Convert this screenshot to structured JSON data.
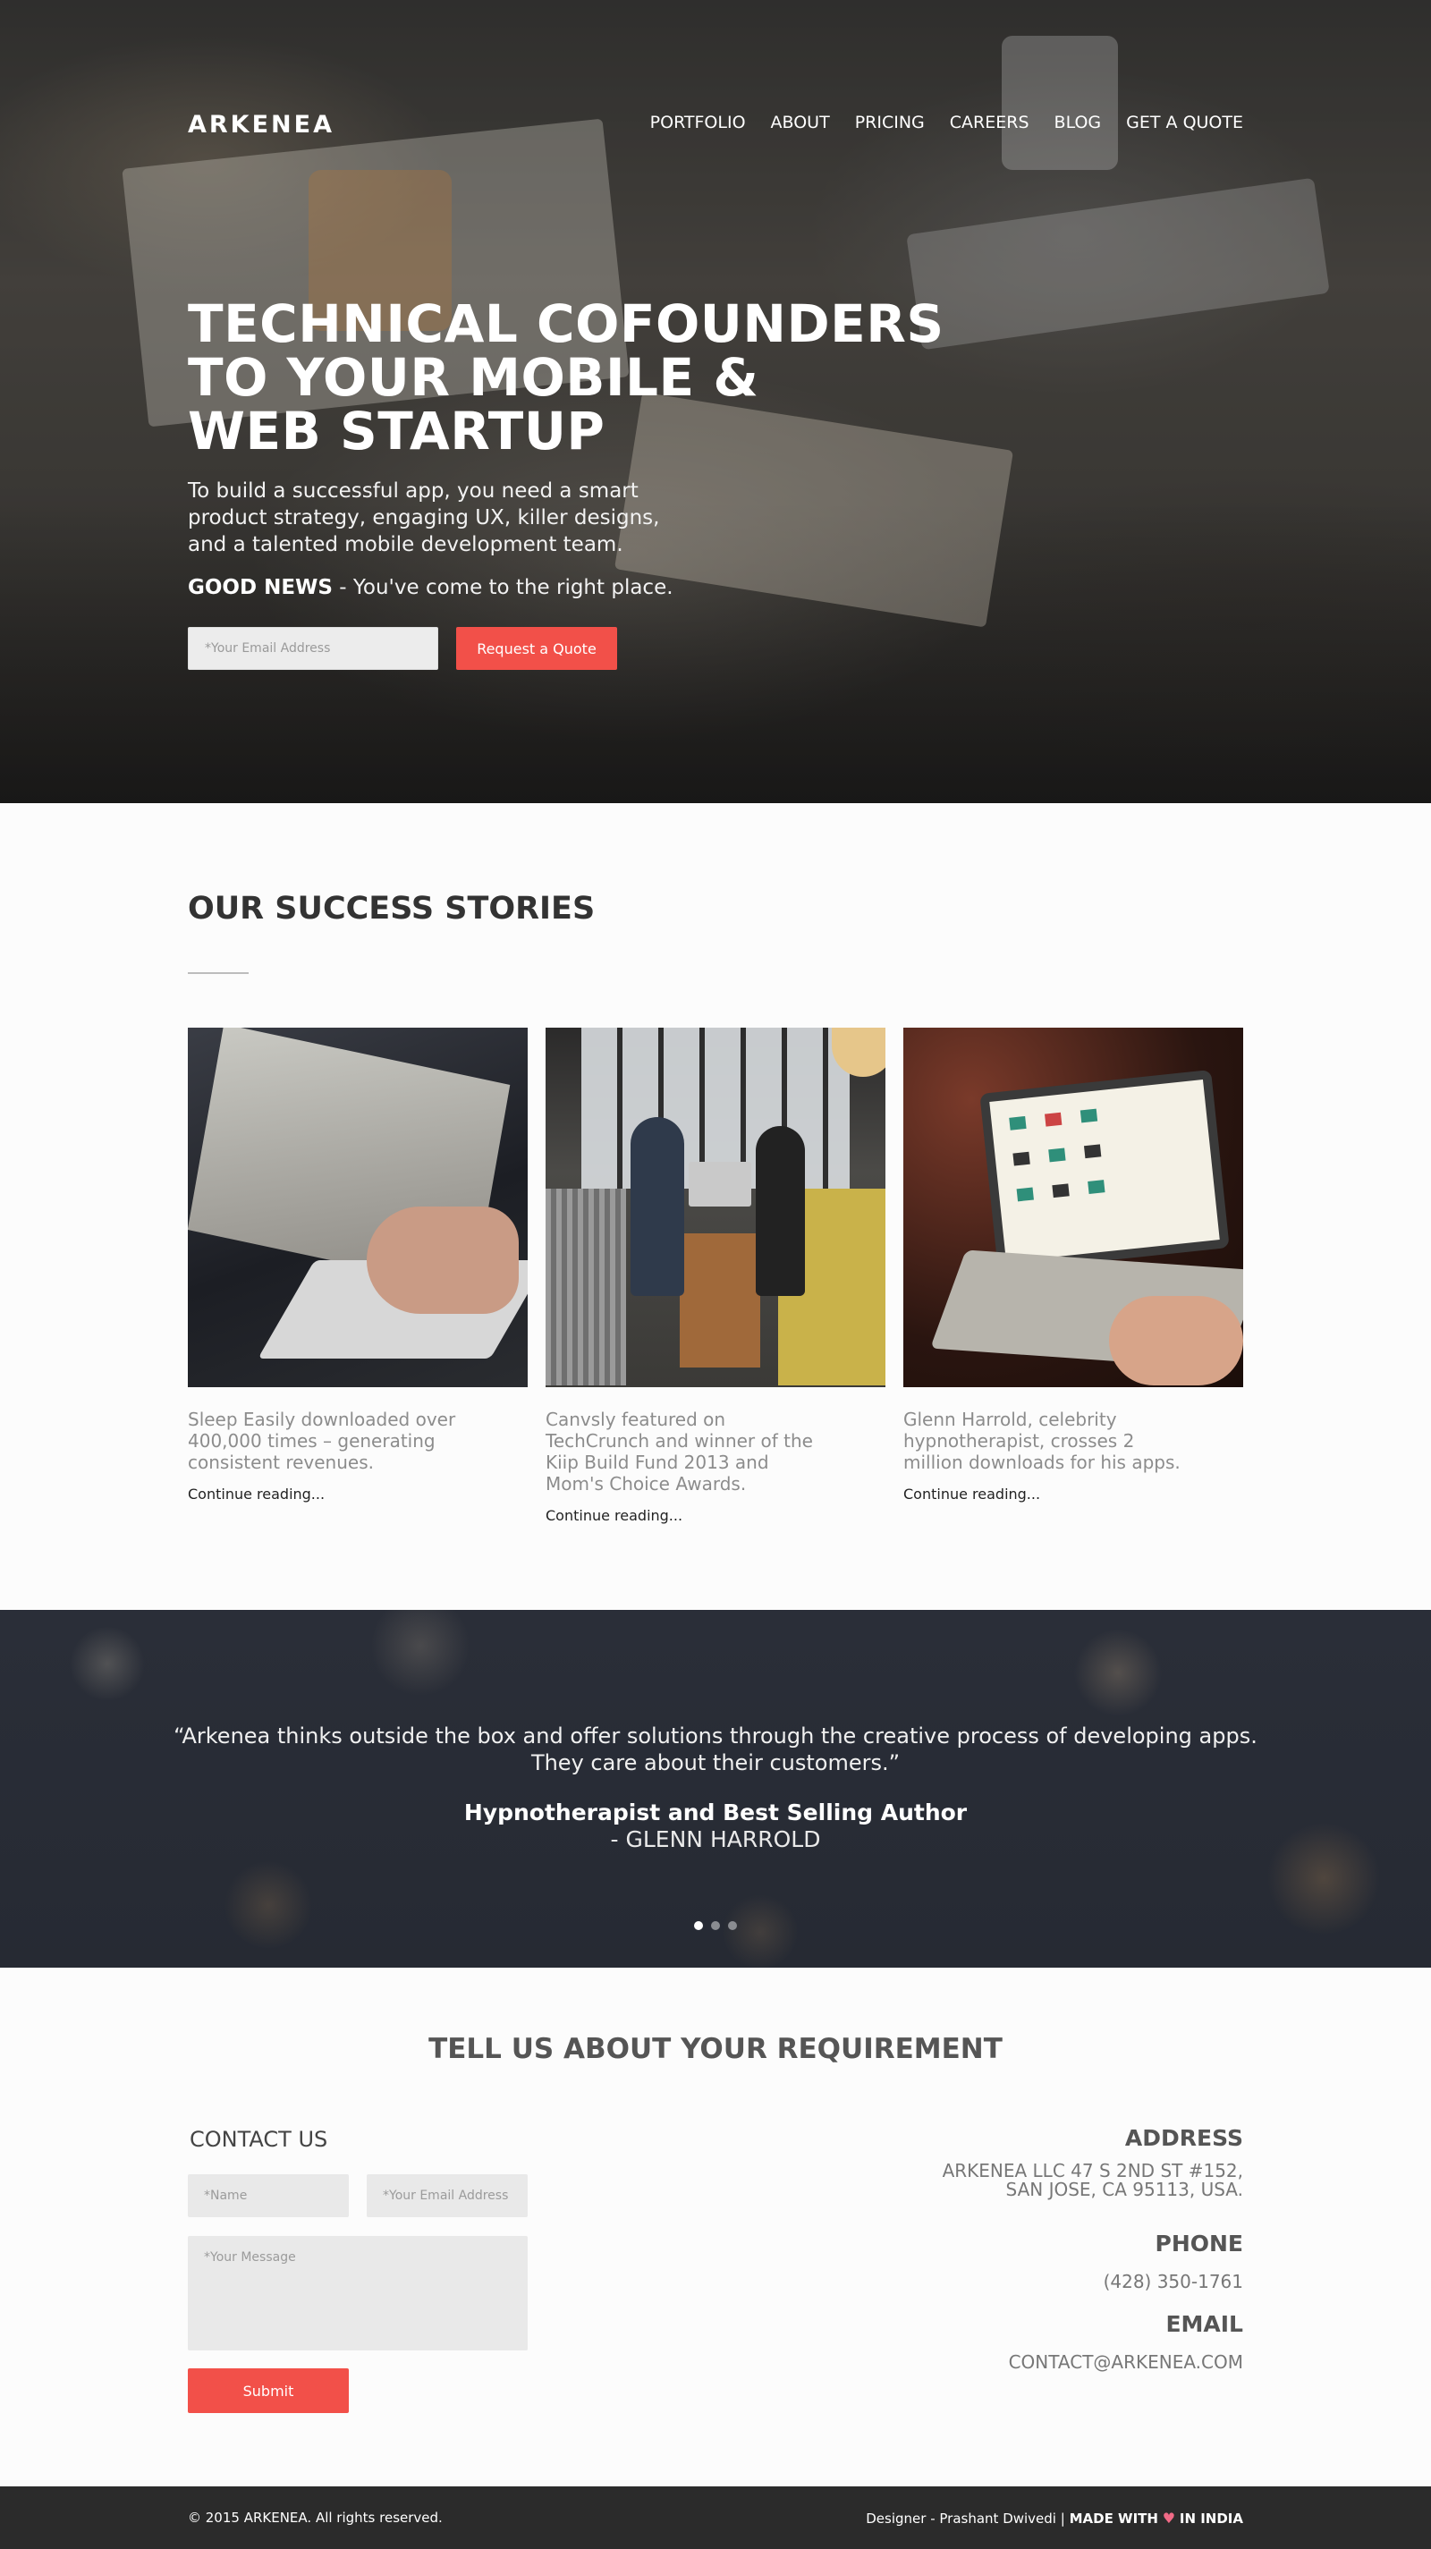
{
  "brand": {
    "logo": "ARKENEA",
    "accent": "#f25049"
  },
  "nav": [
    "PORTFOLIO",
    "ABOUT",
    "PRICING",
    "CAREERS",
    "BLOG",
    "GET A QUOTE"
  ],
  "hero": {
    "title_lines": [
      "TECHNICAL COFOUNDERS",
      "TO YOUR MOBILE &",
      "WEB STARTUP"
    ],
    "subtitle_lines": [
      "To build a successful app, you need a smart",
      "product strategy, engaging UX, killer designs,",
      "and a talented mobile development team."
    ],
    "news_bold": "GOOD NEWS",
    "news_rest": " - You've come to the right place.",
    "email_placeholder": "*Your Email Address",
    "cta": "Request a Quote"
  },
  "stories": {
    "title": "OUR SUCCESS STORIES",
    "items": [
      {
        "desc": "Sleep Easily downloaded over 400,000 times – generating consistent revenues.",
        "link": "Continue reading..."
      },
      {
        "desc": "Canvsly featured on TechCrunch and winner of the Kiip Build Fund 2013 and Mom's Choice Awards.",
        "link": "Continue reading..."
      },
      {
        "desc": "Glenn Harrold, celebrity hypnotherapist, crosses 2 million downloads for his apps.",
        "link": "Continue reading..."
      }
    ]
  },
  "testimonial": {
    "quote_lines": [
      "“Arkenea thinks outside the box and offer solutions through the creative process of developing apps.",
      "They care about their customers.”"
    ],
    "role": "Hypnotherapist and Best Selling Author",
    "name": "- GLENN HARROLD",
    "slides": 3,
    "active_slide": 1
  },
  "contact": {
    "section_title": "TELL US ABOUT YOUR REQUIREMENT",
    "label": "CONTACT US",
    "name_placeholder": "*Name",
    "email_placeholder": "*Your Email Address",
    "message_placeholder": "*Your Message",
    "submit": "Submit",
    "address_title": "ADDRESS",
    "address_lines": [
      "ARKENEA LLC 47 S 2ND ST #152,",
      "SAN JOSE, CA 95113, USA."
    ],
    "phone_title": "PHONE",
    "phone": "(428) 350-1761",
    "email_title": "EMAIL",
    "email": "CONTACT@ARKENEA.COM"
  },
  "footer": {
    "copyright": "© 2015 ARKENEA. All rights reserved.",
    "credit_prefix": "Designer - Prashant Dwivedi | ",
    "credit_bold1": "MADE WITH",
    "heart": "♥",
    "credit_bold2": "IN INDIA"
  }
}
